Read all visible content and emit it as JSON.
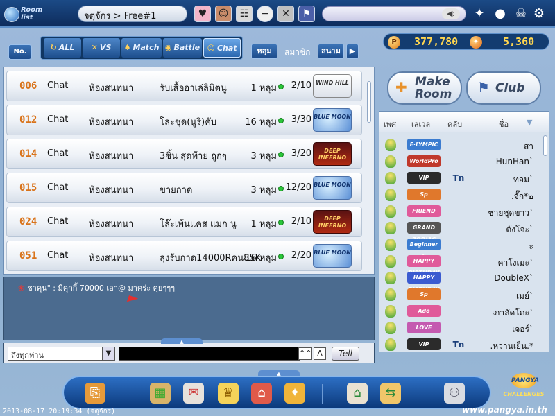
{
  "header": {
    "roomlist_label": "Room\nlist",
    "breadcrumb": "จตุจักร > Free#1",
    "chat_placeholder": ""
  },
  "filters": {
    "no_label": "No.",
    "tabs": [
      {
        "label": "ALL",
        "icon": "refresh-icon"
      },
      {
        "label": "VS",
        "icon": "vs-icon"
      },
      {
        "label": "Match",
        "icon": "match-icon"
      },
      {
        "label": "Battle",
        "icon": "battle-icon"
      },
      {
        "label": "Chat",
        "icon": "chat-icon",
        "selected": true
      }
    ],
    "hole_label": "หลุม",
    "member_label": "สมาชิก",
    "course_label": "สนาม"
  },
  "currency": {
    "pang": "377,780",
    "cookie": "5,360"
  },
  "rooms": [
    {
      "num": "006",
      "type": "Chat",
      "mode": "ห้องสนทนา",
      "title": "รับเสื้ออาเล่ลิมิตนู",
      "holes": "1 หลุม",
      "players": "2/10",
      "course": "WIND HILL"
    },
    {
      "num": "012",
      "type": "Chat",
      "mode": "ห้องสนทนา",
      "title": "โละชุด(นูริ)คับ",
      "holes": "16 หลุม",
      "players": "3/30",
      "course": "BLUE MOON"
    },
    {
      "num": "014",
      "type": "Chat",
      "mode": "ห้องสนทนา",
      "title": "3ชิ้น สุดท้าย ถูกๆ",
      "holes": "3 หลุม",
      "players": "3/20",
      "course": "DEEP INFERNO"
    },
    {
      "num": "015",
      "type": "Chat",
      "mode": "ห้องสนทนา",
      "title": "ขายกาด",
      "holes": "3 หลุม",
      "players": "12/20",
      "course": "BLUE MOON"
    },
    {
      "num": "024",
      "type": "Chat",
      "mode": "ห้องสนทนา",
      "title": "โล๊ะเพ้นแคส แมก นู",
      "holes": "1 หลุม",
      "players": "2/10",
      "course": "DEEP INFERNO"
    },
    {
      "num": "051",
      "type": "Chat",
      "mode": "ห้องสนทนา",
      "title": "ลุงรับกาด14000Rคน85K",
      "holes": "16 หลุม",
      "players": "2/20",
      "course": "BLUE MOON"
    }
  ],
  "chat": {
    "message": "ชาคุน\" : มีคุกกี้ 70000 เอา@ มาคร่ะ คุยๆๆๆ",
    "target": "ถึงทุกท่าน",
    "caret_label": "^^",
    "a_label": "A",
    "tell_label": "Tell"
  },
  "right": {
    "make_room": "Make\nRoom",
    "club": "Club",
    "headers": {
      "sex": "เพศ",
      "level": "เลเวล",
      "club": "คลับ",
      "name": "ชื่อ"
    }
  },
  "users": [
    {
      "level": "E·LYMPIC",
      "club": "",
      "name": "สา"
    },
    {
      "level": "WorldPro",
      "club": "",
      "name": "HunHan`"
    },
    {
      "level": "VIP",
      "club": "Tn",
      "name": "ทอม`"
    },
    {
      "level": "Sp",
      "club": "",
      "name": ".จั๊ก*๒"
    },
    {
      "level": "FRIEND",
      "club": "",
      "name": "ชายชุดขาว`"
    },
    {
      "level": "GRAND ZODIAC",
      "club": "",
      "name": "ตังโจะ`"
    },
    {
      "level": "Beginner E",
      "club": "",
      "name": "ะ"
    },
    {
      "level": "HAPPY BIRTHDAY",
      "club": "",
      "name": "คาโงเมะ`"
    },
    {
      "level": "HAPPY BIRTHDAY",
      "club": "",
      "name": "DoubleX`"
    },
    {
      "level": "Sp",
      "club": "",
      "name": "เมย์`"
    },
    {
      "level": "Ado",
      "club": "",
      "name": "เกาลัดโดะ`"
    },
    {
      "level": "LOVE",
      "club": "",
      "name": "เจอร์`"
    },
    {
      "level": "VIP",
      "club": "Tn",
      "name": ".หวานเย็น.*"
    }
  ],
  "footer": {
    "timestamp": "2013-08-17 20:19:34 (จตุจักร)",
    "site": "www.pangya.in.th",
    "brand": "PANGYA",
    "brand_sub": "CHALLENGES"
  },
  "colors": {
    "accent": "#1e4f8e",
    "room_number": "#d9731a",
    "online_dot": "#2bc63a"
  }
}
